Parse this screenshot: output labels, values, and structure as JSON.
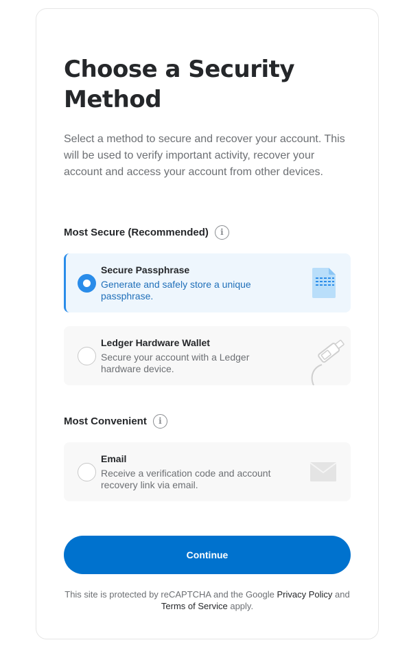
{
  "page": {
    "title": "Choose a Security Method",
    "description": "Select a method to secure and recover your account. This will be used to verify important activity, recover your account and access your account from other devices."
  },
  "sections": [
    {
      "title": "Most Secure (Recommended)",
      "info_icon": "info-icon",
      "options": [
        {
          "title": "Secure Passphrase",
          "description": "Generate and safely store a unique passphrase.",
          "selected": true,
          "icon": "passphrase-document-icon"
        },
        {
          "title": "Ledger Hardware Wallet",
          "description": "Secure your account with a Ledger hardware device.",
          "selected": false,
          "icon": "ledger-device-icon"
        }
      ]
    },
    {
      "title": "Most Convenient",
      "info_icon": "info-icon",
      "options": [
        {
          "title": "Email",
          "description": "Receive a verification code and account recovery link via email.",
          "selected": false,
          "icon": "envelope-icon"
        }
      ]
    }
  ],
  "continue_label": "Continue",
  "footer": {
    "prefix": "This site is protected by reCAPTCHA and the Google ",
    "privacy_link": "Privacy Policy",
    "middle": " and ",
    "terms_link": "Terms of Service",
    "suffix": " apply."
  },
  "colors": {
    "accent": "#2a8ce9",
    "button": "#0072ce",
    "selected_bg": "#eef6fd",
    "option_bg": "#f8f8f8"
  }
}
